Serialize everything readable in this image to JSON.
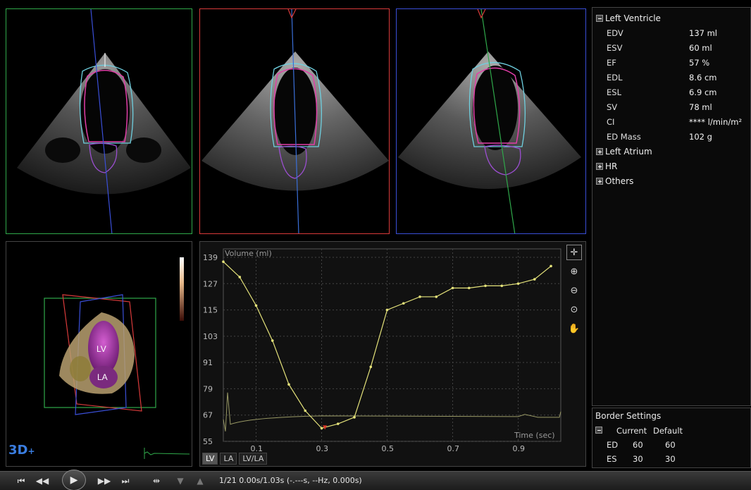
{
  "left_ventricle": {
    "header": "Left Ventricle",
    "rows": [
      {
        "label": "EDV",
        "value": "137 ml"
      },
      {
        "label": "ESV",
        "value": "60 ml"
      },
      {
        "label": "EF",
        "value": "57 %"
      },
      {
        "label": "EDL",
        "value": "8.6 cm"
      },
      {
        "label": "ESL",
        "value": "6.9 cm"
      },
      {
        "label": "SV",
        "value": "78 ml"
      },
      {
        "label": "CI",
        "value": "**** l/min/m²"
      },
      {
        "label": "ED Mass",
        "value": "102 g"
      }
    ]
  },
  "sections": [
    "Left Atrium",
    "HR",
    "Others"
  ],
  "border_settings": {
    "title": "Border Settings",
    "col_current": "Current",
    "col_default": "Default",
    "ed": {
      "label": "ED",
      "current": "60",
      "default": "60"
    },
    "es": {
      "label": "ES",
      "current": "30",
      "default": "30"
    }
  },
  "view3d": {
    "logo": "3D",
    "lv_label": "LV",
    "la_label": "LA"
  },
  "graph_tabs": [
    "LV",
    "LA",
    "LV/LA"
  ],
  "status_text": "1/21  0.00s/1.03s (-.---s, --Hz, 0.000s)",
  "colors": {
    "view1": "#2fa84a",
    "view2": "#d83a3a",
    "view3": "#3a4fd8",
    "curve": "#e4e27a"
  },
  "chart_data": {
    "type": "line",
    "ylabel": "Volume (ml)",
    "xlabel": "Time (sec)",
    "xlim": [
      0,
      1.03
    ],
    "ylim": [
      55,
      139
    ],
    "xticks": [
      0.1,
      0.3,
      0.5,
      0.7,
      0.9
    ],
    "yticks": [
      55,
      67,
      79,
      91,
      103,
      115,
      127,
      139
    ],
    "series": [
      {
        "x": [
          0.0,
          0.05,
          0.1,
          0.15,
          0.2,
          0.25,
          0.3,
          0.35,
          0.4,
          0.45,
          0.5,
          0.55,
          0.6,
          0.65,
          0.7,
          0.75,
          0.8,
          0.85,
          0.9,
          0.95,
          1.0
        ],
        "values": [
          137,
          130,
          117,
          101,
          81,
          69,
          61,
          63,
          66,
          89,
          115,
          118,
          121,
          121,
          125,
          125,
          126,
          126,
          127,
          129,
          135
        ]
      }
    ],
    "ecg_baseline": 66,
    "marker": {
      "x": 0.31,
      "y": 61
    }
  }
}
